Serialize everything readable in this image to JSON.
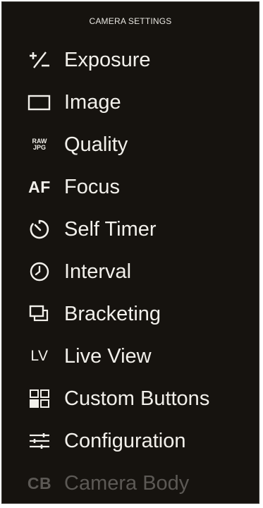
{
  "header": {
    "title": "CAMERA SETTINGS"
  },
  "menu": {
    "items": [
      {
        "label": "Exposure",
        "icon": "exposure-compensation-icon"
      },
      {
        "label": "Image",
        "icon": "image-frame-icon"
      },
      {
        "label": "Quality",
        "icon": "raw-jpg-icon",
        "icon_text_top": "RAW",
        "icon_text_bottom": "JPG"
      },
      {
        "label": "Focus",
        "icon": "af-icon",
        "icon_text": "AF"
      },
      {
        "label": "Self Timer",
        "icon": "self-timer-icon"
      },
      {
        "label": "Interval",
        "icon": "interval-clock-icon"
      },
      {
        "label": "Bracketing",
        "icon": "bracketing-icon"
      },
      {
        "label": "Live View",
        "icon": "lv-icon",
        "icon_text": "LV"
      },
      {
        "label": "Custom Buttons",
        "icon": "custom-buttons-grid-icon"
      },
      {
        "label": "Configuration",
        "icon": "configuration-sliders-icon"
      },
      {
        "label": "Camera Body",
        "icon": "cb-icon",
        "icon_text": "CB",
        "disabled": true
      }
    ]
  },
  "colors": {
    "background": "#16130f",
    "text": "#f2f0eb",
    "disabled_text": "#5c5955"
  }
}
